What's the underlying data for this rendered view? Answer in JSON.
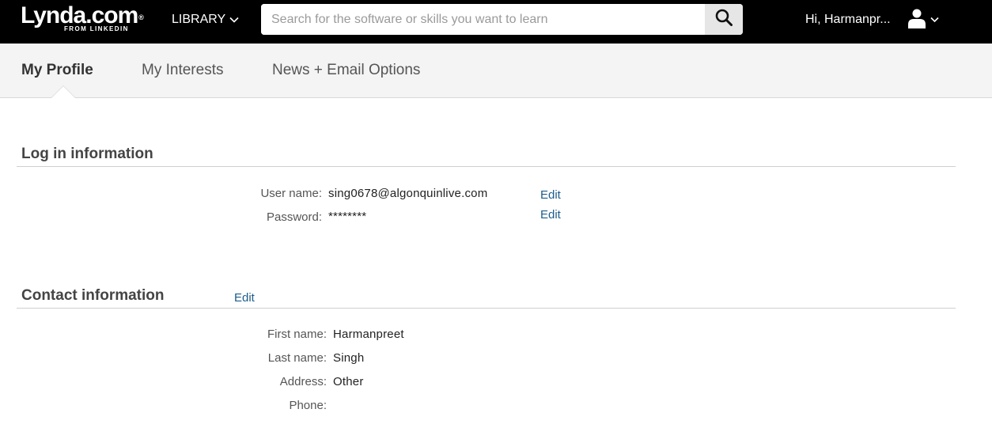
{
  "header": {
    "logo_text": "Lynda.com",
    "logo_reg": "®",
    "logo_subtext": "FROM LINKEDIN",
    "library_label": "LIBRARY",
    "search_placeholder": "Search for the software or skills you want to learn",
    "search_value": "",
    "greeting": "Hi, Harmanpr...",
    "icons": {
      "library": "chevron-down-icon",
      "search": "search-icon",
      "user": "user-icon",
      "user_menu": "chevron-down-icon"
    }
  },
  "tabs": [
    {
      "label": "My Profile",
      "active": true
    },
    {
      "label": "My Interests",
      "active": false
    },
    {
      "label": "News + Email Options",
      "active": false
    }
  ],
  "login_section": {
    "title": "Log in information",
    "fields": [
      {
        "label": "User name:",
        "value": "sing0678@algonquinlive.com",
        "action": "Edit"
      },
      {
        "label": "Password:",
        "value": "********",
        "action": "Edit"
      }
    ]
  },
  "contact_section": {
    "title": "Contact information",
    "action": "Edit",
    "fields": [
      {
        "label": "First name:",
        "value": "Harmanpreet"
      },
      {
        "label": "Last name:",
        "value": "Singh"
      },
      {
        "label": "Address:",
        "value": "Other"
      },
      {
        "label": "Phone:",
        "value": ""
      }
    ]
  },
  "colors": {
    "topbar": "#000000",
    "tabbar": "#f4f4f4",
    "link": "#1c5d8c",
    "heading": "#444444"
  }
}
